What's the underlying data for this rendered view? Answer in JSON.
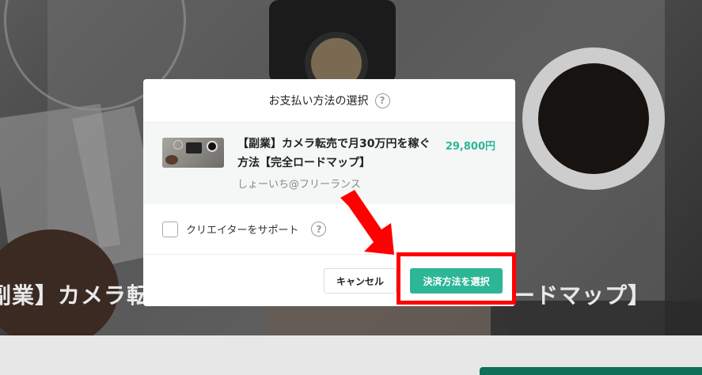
{
  "background": {
    "title_left": "副業】カメラ転",
    "title_right": "ードマップ】"
  },
  "modal": {
    "title": "お支払い方法の選択",
    "help_glyph": "?",
    "product": {
      "name": "【副業】カメラ転売で月30万円を稼ぐ方法【完全ロードマップ】",
      "author": "しょーいち@フリーランス",
      "price": "29,800円"
    },
    "support_label": "クリエイターをサポート",
    "cancel_label": "キャンセル",
    "select_label": "決済方法を選択"
  },
  "colors": {
    "accent": "#2cb696",
    "highlight": "#ff0000"
  }
}
